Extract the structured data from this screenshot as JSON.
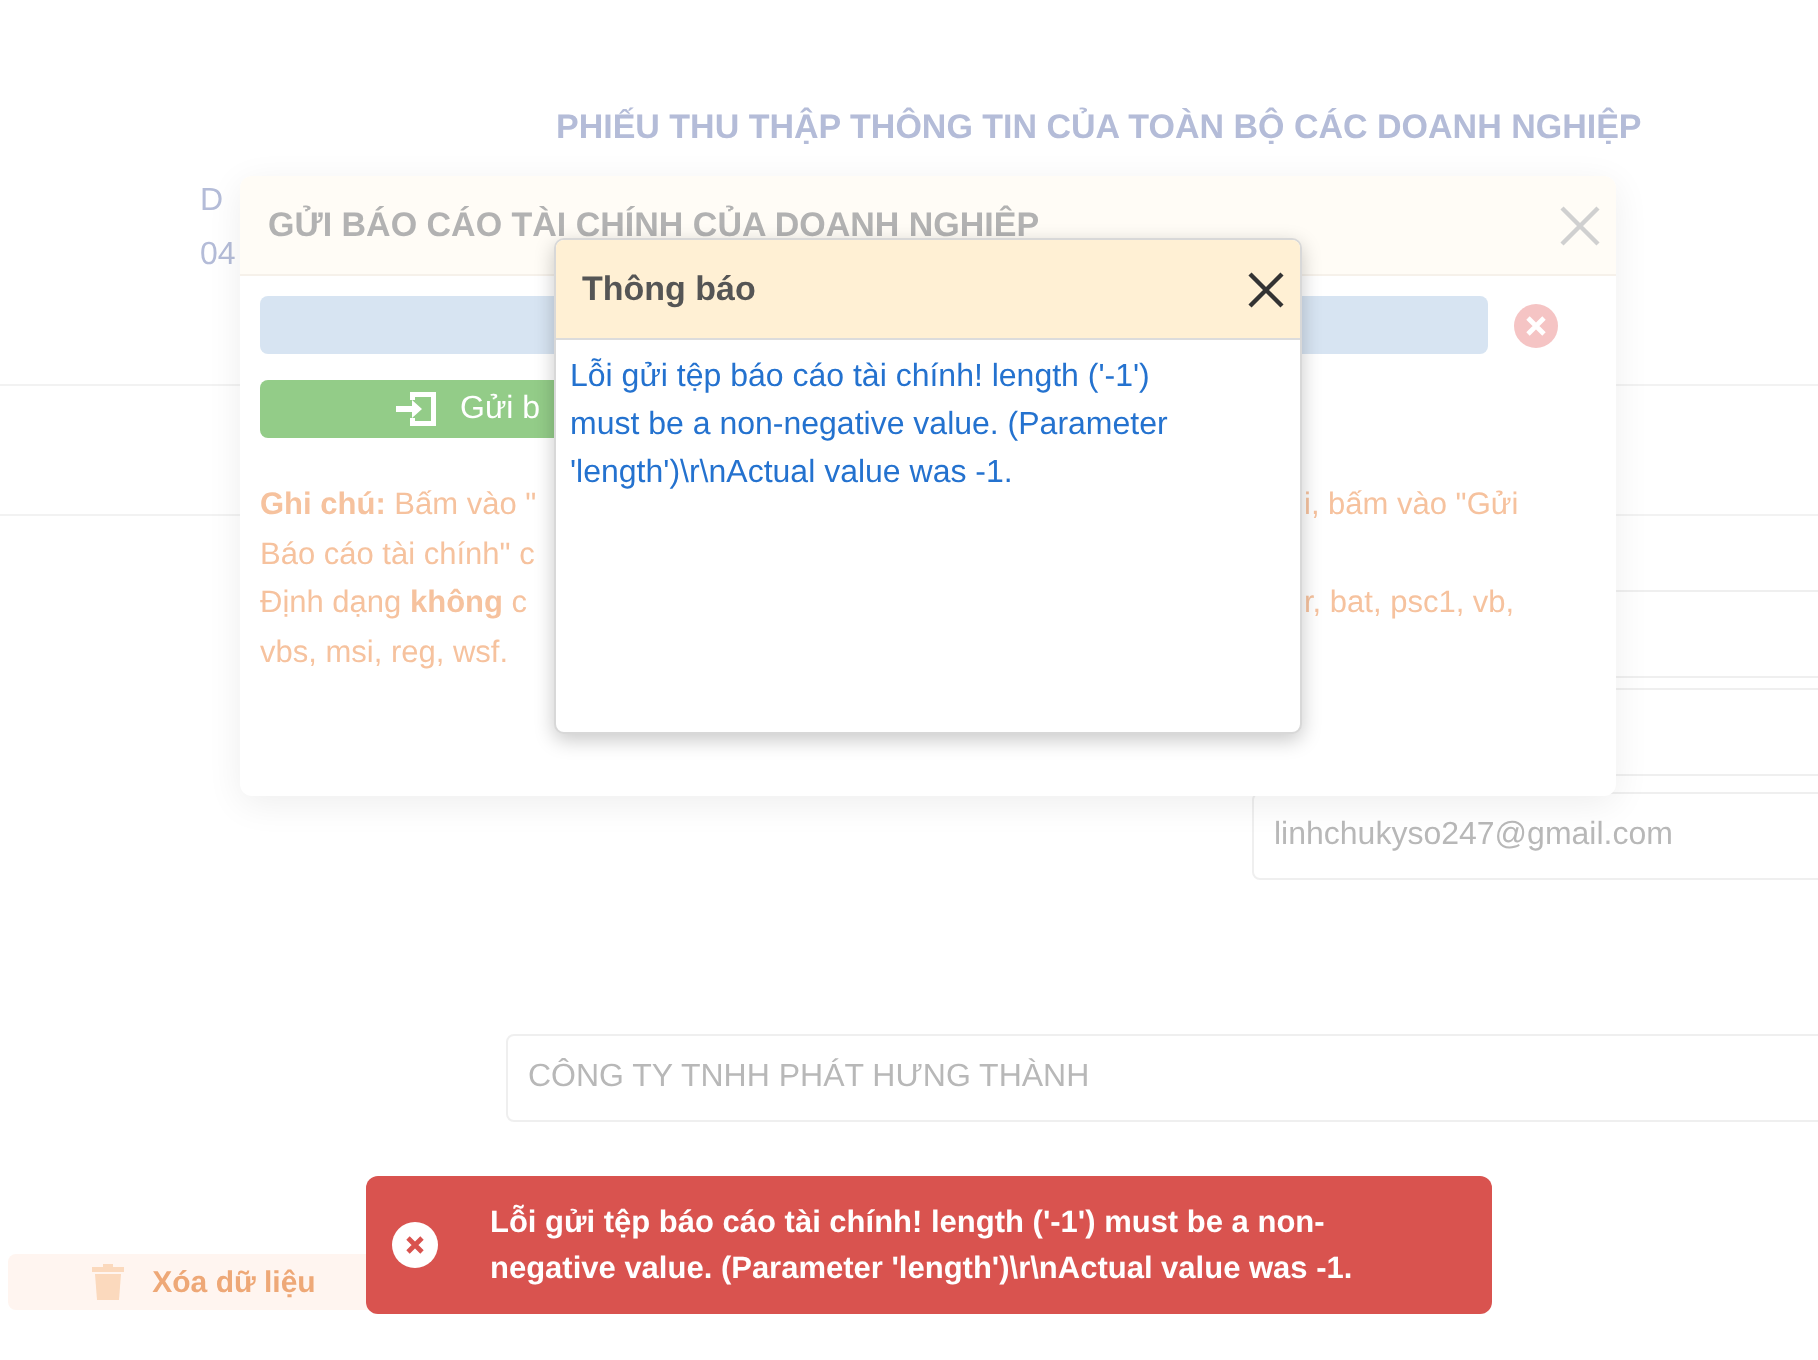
{
  "page": {
    "title": "PHIẾU THU THẬP THÔNG TIN CỦA TOÀN BỘ CÁC DOANH NGHIỆP",
    "side_labels": [
      "D",
      "04"
    ],
    "fields": [
      {
        "value": "linhchukyso247@gmail.com"
      },
      {
        "value": "CÔNG TY TNHH PHÁT HƯNG THÀNH"
      }
    ],
    "delete_button": {
      "label": "Xóa dữ liệu"
    }
  },
  "upload_dialog": {
    "title": "GỬI BÁO CÁO TÀI CHÍNH CỦA DOANH NGHIỆP",
    "send_button": {
      "label": "Gửi b"
    },
    "note_lines": [
      {
        "left": "**Ghi chú:** Bấm vào \"",
        "right": "i, bấm vào \"Gửi"
      },
      {
        "left": "Báo cáo tài chính\" c"
      },
      {
        "left": "Định dạng **không** c",
        "right": "r, bat, psc1, vb,"
      },
      {
        "left": "vbs, msi, reg, wsf."
      }
    ]
  },
  "notice_dialog": {
    "title": "Thông báo",
    "message": "Lỗi gửi tệp báo cáo tài chính! length ('-1') must be a non-negative value. (Parameter 'length')\\r\\nActual value was -1."
  },
  "toast": {
    "kind": "error",
    "message": "Lỗi gửi tệp báo cáo tài chính! length ('-1') must be a non-negative value. (Parameter 'length')\\r\\nActual value was -1."
  }
}
